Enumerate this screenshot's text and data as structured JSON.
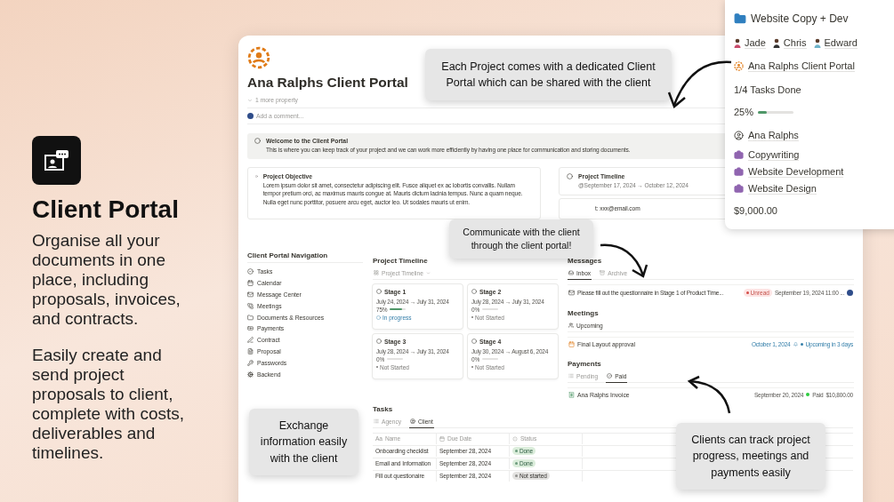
{
  "hero": {
    "title": "Client Portal",
    "paragraphs": [
      "Organise all your documents in one place, including proposals, invoices, and contracts.",
      "Easily create and send project proposals to client, complete with costs, deliverables and timelines."
    ]
  },
  "page": {
    "title": "Ana Ralphs Client Portal",
    "property_toggle": "1 more property",
    "comment_placeholder": "Add a comment...",
    "welcome": {
      "title": "Welcome to the Client Portal",
      "text": "This is where you can keep track of your project and we can work more efficiently by having one place for communication and storing documents."
    },
    "objective": {
      "title": "Project Objective",
      "text": "Lorem ipsum dolor sit amet, consectetur adipiscing elit. Fusce aliquet ex ac lobortis convallis. Nullam tempor pretium orci, ac maximus mauris congue at. Mauris dictum lacinia tempus. Nunc a quam neque. Nulla eget nunc porttitor, posuere arcu eget, auctor leo. Ut sodales mauris ut enim."
    },
    "timeline_card": {
      "title": "Project Timeline",
      "dates": "@September 17, 2024 → October 12, 2024"
    },
    "contact": "t: xxx@email.com",
    "navigation": {
      "title": "Client Portal Navigation",
      "items": [
        "Tasks",
        "Calendar",
        "Message Center",
        "Meetings",
        "Documents & Resources",
        "Payments",
        "Contract",
        "Proposal",
        "Passwords",
        "Backend"
      ]
    },
    "timeline": {
      "title": "Project Timeline",
      "view": "Project Timeline",
      "stages": [
        {
          "name": "Stage 1",
          "dates": "July 24, 2024 → July 31, 2024",
          "percent": "75%",
          "level": 0.75,
          "status": "In progress",
          "kind": "in_progress"
        },
        {
          "name": "Stage 2",
          "dates": "July 28, 2024 → July 31, 2024",
          "percent": "0%",
          "level": 0,
          "status": "Not Started",
          "kind": "not_started"
        },
        {
          "name": "Stage 3",
          "dates": "July 28, 2024 → July 31, 2024",
          "percent": "0%",
          "level": 0,
          "status": "Not Started",
          "kind": "not_started"
        },
        {
          "name": "Stage 4",
          "dates": "July 30, 2024 → August 6, 2024",
          "percent": "0%",
          "level": 0,
          "status": "Not Started",
          "kind": "not_started"
        }
      ]
    },
    "messages": {
      "title": "Messages",
      "tabs": [
        {
          "label": "Inbox",
          "selected": true
        },
        {
          "label": "Archive",
          "selected": false
        }
      ],
      "rows": [
        {
          "subject": "Please fill out the questionnaire in Stage 1 of Product Time...",
          "badge": "Unread",
          "date": "September 19, 2024 11:00 ..."
        }
      ]
    },
    "meetings": {
      "title": "Meetings",
      "view": "Upcoming",
      "rows": [
        {
          "name": "Final Layout approval",
          "date": "October 1, 2024",
          "status": "Upcoming in 3 days"
        }
      ]
    },
    "payments": {
      "title": "Payments",
      "tabs": [
        {
          "label": "Pending",
          "selected": false
        },
        {
          "label": "Paid",
          "selected": true
        }
      ],
      "rows": [
        {
          "name": "Ana Ralphs Invoice",
          "date": "September 20, 2024",
          "status": "Paid",
          "amount": "$10,800.00"
        }
      ]
    },
    "tasks": {
      "title": "Tasks",
      "tabs": [
        {
          "label": "Agency",
          "selected": false
        },
        {
          "label": "Client",
          "selected": true
        }
      ],
      "columns": [
        {
          "label": "Name",
          "glyph": "Aa"
        },
        {
          "label": "Due Date"
        },
        {
          "label": "Status"
        }
      ],
      "rows": [
        {
          "name": "Onboarding checklist",
          "due": "September 28, 2024",
          "status": "Done",
          "kind": "done"
        },
        {
          "name": "Email and Information",
          "due": "September 28, 2024",
          "status": "Done",
          "kind": "done"
        },
        {
          "name": "Fill out questionaire",
          "due": "September 28, 2024",
          "status": "Not started",
          "kind": "not_started"
        }
      ]
    }
  },
  "popup": {
    "title": "Website Copy + Dev",
    "people": [
      "Jade",
      "Chris",
      "Edward"
    ],
    "portal": "Ana Ralphs Client Portal",
    "tasks_done": "1/4 Tasks Done",
    "progress": {
      "reading": "25%",
      "level": 0.25
    },
    "client": "Ana Ralphs",
    "services": [
      "Copywriting",
      "Website Development",
      "Website Design"
    ],
    "budget": "$9,000.00"
  },
  "callouts": [
    {
      "text": "Each Project comes with a dedicated Client Portal which can be shared with the client"
    },
    {
      "text": "Communicate with the client through the client portal!"
    },
    {
      "text": "Exchange information easily with the client"
    },
    {
      "text": "Clients can track project progress, meetings and payments easily"
    }
  ]
}
